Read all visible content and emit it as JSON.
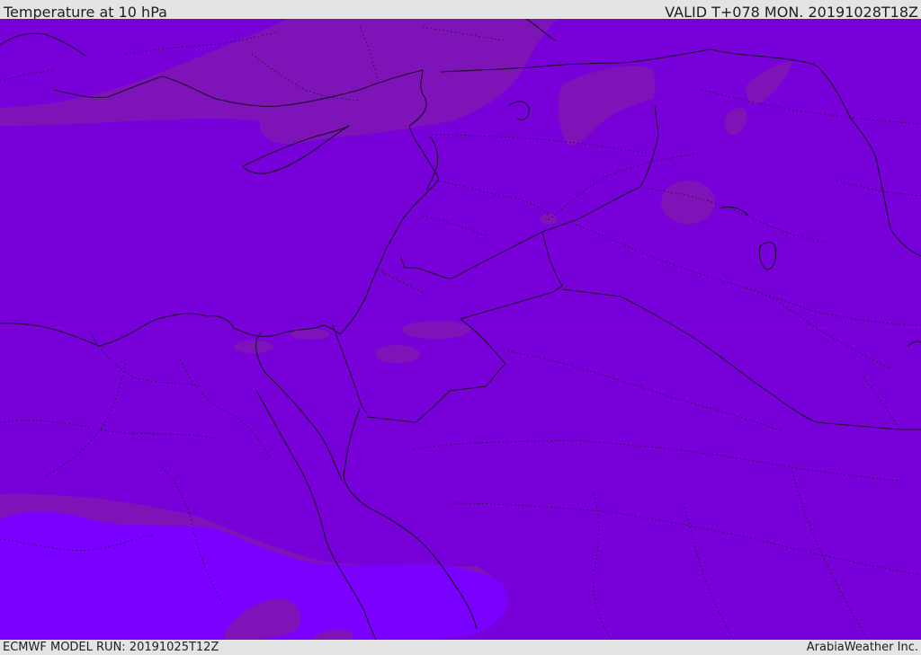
{
  "header": {
    "title": "Temperature at 10 hPa",
    "valid": "VALID T+078 MON. 20191028T18Z"
  },
  "footer": {
    "model_run": "ECMWF MODEL RUN: 20191025T12Z",
    "credit": "ArabiaWeather Inc."
  },
  "colors": {
    "base_field": "#7800d8",
    "warmer_band": "#7e14b8",
    "cold_field": "#7a00ff",
    "coastline": "#1a0a2a"
  }
}
